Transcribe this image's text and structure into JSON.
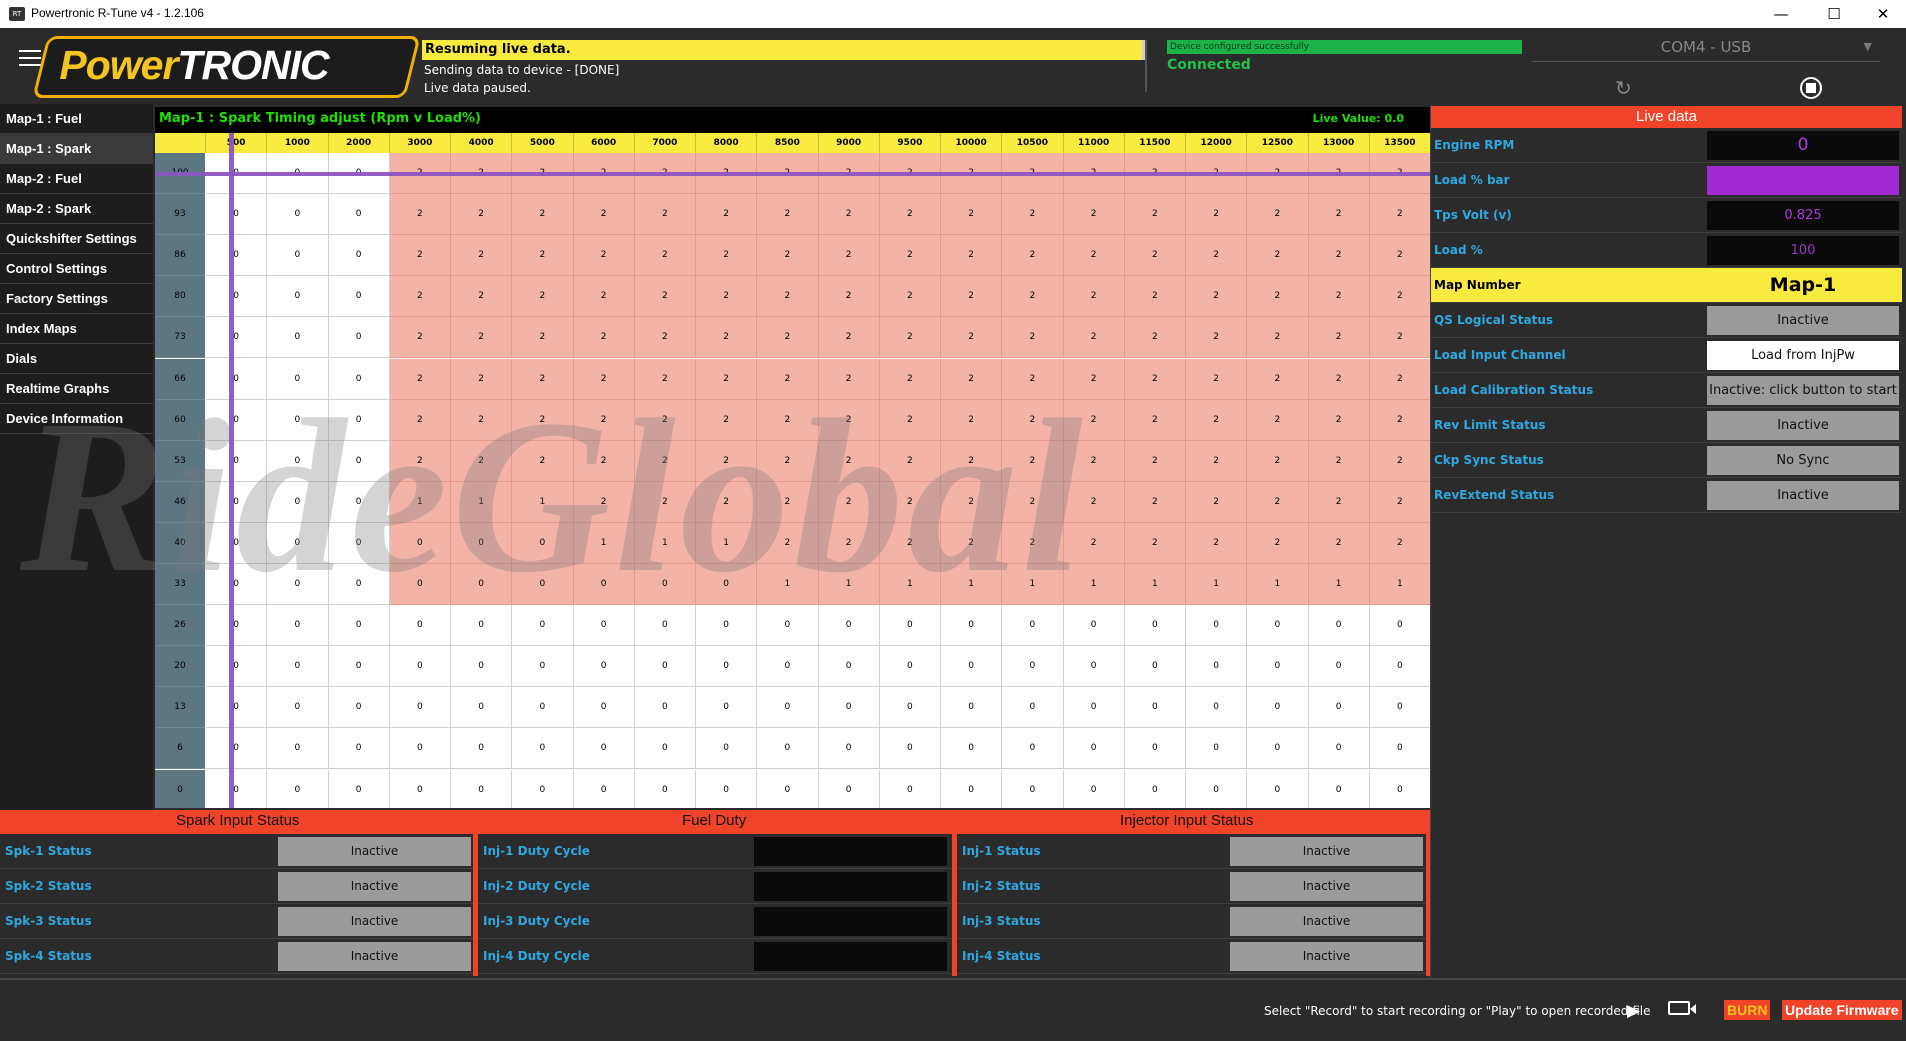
{
  "window": {
    "title": "Powertronic R-Tune v4 - 1.2.106",
    "minimize": "—",
    "maximize": "☐",
    "close": "✕"
  },
  "header": {
    "logo_left": "Power",
    "logo_right": "TRONIC",
    "status_main": "Resuming live data.",
    "status_line2": "Sending data to device - [DONE]",
    "status_line3": "Live data paused.",
    "device_msg": "Device configured successfully",
    "connection": "Connected",
    "port": "COM4 - USB"
  },
  "sidebar": {
    "items": [
      {
        "label": "Map-1 : Fuel"
      },
      {
        "label": "Map-1 : Spark"
      },
      {
        "label": "Map-2 : Fuel"
      },
      {
        "label": "Map-2 : Spark"
      },
      {
        "label": "Quickshifter Settings"
      },
      {
        "label": "Control Settings"
      },
      {
        "label": "Factory Settings"
      },
      {
        "label": "Index Maps"
      },
      {
        "label": "Dials"
      },
      {
        "label": "Realtime Graphs"
      },
      {
        "label": "Device Information"
      }
    ],
    "active_index": 1
  },
  "map": {
    "title": "Map-1 : Spark Timing adjust (Rpm v Load%)",
    "live_value": "Live Value: 0.0",
    "rpm": [
      "500",
      "1000",
      "2000",
      "3000",
      "4000",
      "5000",
      "6000",
      "7000",
      "8000",
      "8500",
      "9000",
      "9500",
      "10000",
      "10500",
      "11000",
      "11500",
      "12000",
      "12500",
      "13000",
      "13500"
    ],
    "load": [
      "100",
      "93",
      "86",
      "80",
      "73",
      "66",
      "60",
      "53",
      "46",
      "40",
      "33",
      "26",
      "20",
      "13",
      "6",
      "0"
    ],
    "values": [
      [
        0,
        0,
        0,
        2,
        2,
        2,
        2,
        2,
        2,
        2,
        2,
        2,
        2,
        2,
        2,
        2,
        2,
        2,
        2,
        2
      ],
      [
        0,
        0,
        0,
        2,
        2,
        2,
        2,
        2,
        2,
        2,
        2,
        2,
        2,
        2,
        2,
        2,
        2,
        2,
        2,
        2
      ],
      [
        0,
        0,
        0,
        2,
        2,
        2,
        2,
        2,
        2,
        2,
        2,
        2,
        2,
        2,
        2,
        2,
        2,
        2,
        2,
        2
      ],
      [
        0,
        0,
        0,
        2,
        2,
        2,
        2,
        2,
        2,
        2,
        2,
        2,
        2,
        2,
        2,
        2,
        2,
        2,
        2,
        2
      ],
      [
        0,
        0,
        0,
        2,
        2,
        2,
        2,
        2,
        2,
        2,
        2,
        2,
        2,
        2,
        2,
        2,
        2,
        2,
        2,
        2
      ],
      [
        0,
        0,
        0,
        2,
        2,
        2,
        2,
        2,
        2,
        2,
        2,
        2,
        2,
        2,
        2,
        2,
        2,
        2,
        2,
        2
      ],
      [
        0,
        0,
        0,
        2,
        2,
        2,
        2,
        2,
        2,
        2,
        2,
        2,
        2,
        2,
        2,
        2,
        2,
        2,
        2,
        2
      ],
      [
        0,
        0,
        0,
        2,
        2,
        2,
        2,
        2,
        2,
        2,
        2,
        2,
        2,
        2,
        2,
        2,
        2,
        2,
        2,
        2
      ],
      [
        0,
        0,
        0,
        1,
        1,
        1,
        2,
        2,
        2,
        2,
        2,
        2,
        2,
        2,
        2,
        2,
        2,
        2,
        2,
        2
      ],
      [
        0,
        0,
        0,
        0,
        0,
        0,
        1,
        1,
        1,
        2,
        2,
        2,
        2,
        2,
        2,
        2,
        2,
        2,
        2,
        2
      ],
      [
        0,
        0,
        0,
        0,
        0,
        0,
        0,
        0,
        0,
        1,
        1,
        1,
        1,
        1,
        1,
        1,
        1,
        1,
        1,
        1
      ],
      [
        0,
        0,
        0,
        0,
        0,
        0,
        0,
        0,
        0,
        0,
        0,
        0,
        0,
        0,
        0,
        0,
        0,
        0,
        0,
        0
      ],
      [
        0,
        0,
        0,
        0,
        0,
        0,
        0,
        0,
        0,
        0,
        0,
        0,
        0,
        0,
        0,
        0,
        0,
        0,
        0,
        0
      ],
      [
        0,
        0,
        0,
        0,
        0,
        0,
        0,
        0,
        0,
        0,
        0,
        0,
        0,
        0,
        0,
        0,
        0,
        0,
        0,
        0
      ],
      [
        0,
        0,
        0,
        0,
        0,
        0,
        0,
        0,
        0,
        0,
        0,
        0,
        0,
        0,
        0,
        0,
        0,
        0,
        0,
        0
      ],
      [
        0,
        0,
        0,
        0,
        0,
        0,
        0,
        0,
        0,
        0,
        0,
        0,
        0,
        0,
        0,
        0,
        0,
        0,
        0,
        0
      ]
    ],
    "highlight_rows": 11,
    "highlight_from_col": 3,
    "watermark": "RideGlobal"
  },
  "live": {
    "heading": "Live data",
    "rows": [
      {
        "label": "Engine RPM",
        "value": "0",
        "style": "dark",
        "color": "#b13be0"
      },
      {
        "label": "Load % bar",
        "value": "",
        "style": "purple",
        "color": "#a32ad1"
      },
      {
        "label": "Tps Volt (v)",
        "value": "0.825",
        "style": "dark",
        "color": "#b13be0"
      },
      {
        "label": "Load %",
        "value": "100",
        "style": "dark",
        "color": "#9b34c9"
      },
      {
        "label": "Map Number",
        "value": "Map-1",
        "style": "map",
        "color": "#000000"
      },
      {
        "label": "QS Logical Status",
        "value": "Inactive",
        "style": "gray",
        "color": "#111111"
      },
      {
        "label": "Load Input Channel",
        "value": "Load from InjPw",
        "style": "white",
        "color": "#111111"
      },
      {
        "label": "Load Calibration Status",
        "value": "Inactive: click button to start",
        "style": "gray",
        "color": "#111111"
      },
      {
        "label": "Rev Limit Status",
        "value": "Inactive",
        "style": "gray",
        "color": "#111111"
      },
      {
        "label": "Ckp Sync Status",
        "value": "No Sync",
        "style": "gray",
        "color": "#111111"
      },
      {
        "label": "RevExtend Status",
        "value": "Inactive",
        "style": "gray",
        "color": "#111111"
      }
    ]
  },
  "spark": {
    "heading": "Spark Input Status",
    "rows": [
      {
        "label": "Spk-1 Status",
        "value": "Inactive"
      },
      {
        "label": "Spk-2 Status",
        "value": "Inactive"
      },
      {
        "label": "Spk-3 Status",
        "value": "Inactive"
      },
      {
        "label": "Spk-4 Status",
        "value": "Inactive"
      }
    ]
  },
  "fuel": {
    "heading": "Fuel Duty",
    "rows": [
      {
        "label": "Inj-1 Duty Cycle",
        "value": ""
      },
      {
        "label": "Inj-2 Duty Cycle",
        "value": ""
      },
      {
        "label": "Inj-3 Duty Cycle",
        "value": ""
      },
      {
        "label": "Inj-4 Duty Cycle",
        "value": ""
      }
    ]
  },
  "injector": {
    "heading": "Injector Input Status",
    "rows": [
      {
        "label": "Inj-1 Status",
        "value": "Inactive"
      },
      {
        "label": "Inj-2 Status",
        "value": "Inactive"
      },
      {
        "label": "Inj-3 Status",
        "value": "Inactive"
      },
      {
        "label": "Inj-4 Status",
        "value": "Inactive"
      }
    ]
  },
  "footer": {
    "record_hint": "Select \"Record\" to start recording or \"Play\" to open recorded file",
    "play_icon": "▶",
    "burn": "BURN",
    "update": "Update Firmware"
  },
  "colors": {
    "accent_red": "#f0432a",
    "status_yellow": "#f9ea40",
    "live_green": "#20e000",
    "label_blue": "#2fa8e0",
    "cell_highlight": "#f4b3a7",
    "cursor": "#8c55c2"
  }
}
